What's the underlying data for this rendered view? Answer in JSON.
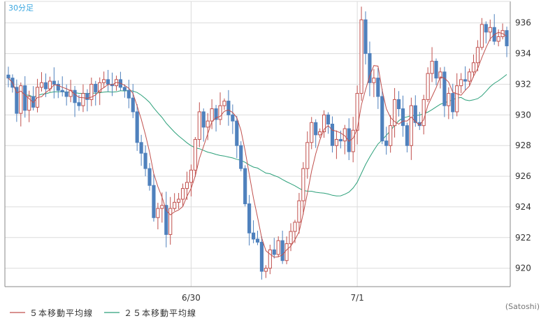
{
  "chart_data": {
    "type": "candlestick",
    "timeframe_label": "30分足",
    "credit": "(Satoshi)",
    "grid": true,
    "ylim": [
      918.8,
      937.4
    ],
    "yticks": [
      "936",
      "934",
      "932",
      "930",
      "928",
      "926",
      "924",
      "922",
      "920"
    ],
    "ytick_values": [
      936,
      934,
      932,
      930,
      928,
      926,
      924,
      922,
      920
    ],
    "date_labels": [
      {
        "label": "6/30",
        "index": 44
      },
      {
        "label": "7/1",
        "index": 84
      }
    ],
    "colors": {
      "up": "#c0504d",
      "down": "#4f81bd",
      "ma5": "#c0504d",
      "ma25": "#2ca07a",
      "grid": "#dcdcdc",
      "axis": "#888888"
    },
    "legend": [
      {
        "name": "５本移動平均線",
        "color": "#c0504d"
      },
      {
        "name": "２５本移動平均線",
        "color": "#2ca07a"
      }
    ],
    "closes": [
      932.4,
      931.8,
      930.1,
      931.9,
      930.3,
      931.2,
      930.5,
      931.8,
      932.1,
      931.7,
      932.2,
      932.0,
      931.6,
      931.5,
      931.2,
      931.6,
      930.8,
      930.6,
      931.4,
      931.0,
      932.0,
      931.5,
      932.1,
      932.3,
      932.0,
      931.9,
      932.3,
      931.8,
      931.6,
      931.1,
      930.2,
      928.2,
      927.5,
      926.5,
      925.4,
      923.3,
      923.9,
      924.1,
      922.2,
      923.9,
      924.3,
      924.5,
      925.2,
      925.6,
      926.4,
      928.4,
      930.2,
      929.2,
      929.6,
      930.4,
      929.7,
      930.6,
      930.9,
      930.0,
      929.6,
      928.0,
      926.5,
      924.2,
      922.3,
      921.9,
      921.7,
      919.8,
      920.0,
      921.2,
      920.9,
      921.8,
      920.5,
      921.6,
      922.4,
      923.0,
      924.4,
      926.5,
      928.2,
      929.5,
      928.7,
      928.9,
      930.0,
      929.4,
      928.0,
      928.4,
      928.3,
      929.1,
      927.6,
      929.0,
      931.4,
      936.2,
      934.0,
      932.1,
      932.4,
      931.2,
      928.3,
      928.0,
      929.3,
      931.0,
      930.4,
      929.3,
      928.0,
      930.6,
      929.5,
      929.3,
      931.0,
      932.7,
      933.5,
      932.4,
      932.8,
      930.6,
      931.4,
      930.2,
      931.9,
      932.3,
      932.2,
      932.8,
      933.4,
      934.4,
      935.9,
      935.4,
      935.7,
      934.8,
      935.1,
      935.5,
      934.5
    ],
    "opens": [
      932.6,
      932.4,
      931.8,
      930.1,
      931.9,
      930.3,
      931.2,
      930.5,
      931.8,
      932.1,
      931.7,
      932.2,
      932.0,
      931.6,
      931.5,
      931.2,
      931.6,
      930.8,
      930.6,
      931.4,
      931.0,
      932.0,
      931.5,
      932.1,
      932.3,
      932.0,
      931.9,
      932.3,
      931.8,
      931.6,
      931.1,
      930.2,
      928.2,
      927.5,
      926.5,
      925.4,
      923.3,
      923.9,
      924.1,
      922.2,
      923.9,
      924.3,
      924.5,
      925.2,
      925.6,
      926.4,
      928.4,
      930.2,
      929.2,
      929.6,
      930.4,
      929.7,
      930.6,
      930.9,
      930.0,
      929.6,
      928.0,
      926.5,
      924.2,
      922.3,
      921.9,
      921.7,
      919.8,
      920.0,
      921.2,
      920.9,
      921.8,
      920.5,
      921.6,
      922.4,
      923.0,
      924.4,
      926.5,
      928.2,
      929.5,
      928.7,
      928.9,
      930.0,
      929.4,
      928.0,
      928.4,
      928.3,
      929.1,
      927.6,
      929.0,
      931.4,
      936.2,
      934.0,
      932.1,
      932.4,
      931.2,
      928.3,
      928.0,
      929.3,
      931.0,
      930.4,
      929.3,
      928.0,
      930.6,
      929.5,
      929.3,
      931.0,
      932.7,
      933.5,
      932.4,
      932.8,
      930.6,
      931.4,
      930.2,
      931.9,
      932.3,
      932.2,
      932.8,
      933.4,
      934.4,
      935.9,
      935.4,
      935.7,
      934.8,
      935.1,
      935.5
    ]
  }
}
